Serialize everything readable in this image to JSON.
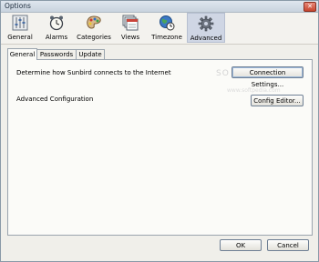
{
  "window": {
    "title": "Options",
    "close_glyph": "✕"
  },
  "toolbar": {
    "items": [
      {
        "label": "General",
        "icon": "sliders-icon"
      },
      {
        "label": "Alarms",
        "icon": "alarm-clock-icon"
      },
      {
        "label": "Categories",
        "icon": "palette-icon"
      },
      {
        "label": "Views",
        "icon": "calendar-views-icon"
      },
      {
        "label": "Timezone",
        "icon": "globe-clock-icon"
      },
      {
        "label": "Advanced",
        "icon": "gear-icon"
      }
    ],
    "selected": "Advanced"
  },
  "tabs": [
    {
      "label": "General",
      "active": true
    },
    {
      "label": "Passwords",
      "active": false
    },
    {
      "label": "Update",
      "active": false
    }
  ],
  "general_tab": {
    "connection_text": "Determine how Sunbird connects to the Internet",
    "connection_button": "Connection Settings...",
    "advanced_text": "Advanced Configuration",
    "config_button": "Config Editor...",
    "watermark": "SO",
    "watermark_small": "www.softpedia.com"
  },
  "footer": {
    "ok_label": "OK",
    "cancel_label": "Cancel"
  },
  "colors": {
    "selected_pane": "#cfd6e4",
    "panel_bg": "#fbfbf8",
    "window_bg": "#f0efea"
  }
}
